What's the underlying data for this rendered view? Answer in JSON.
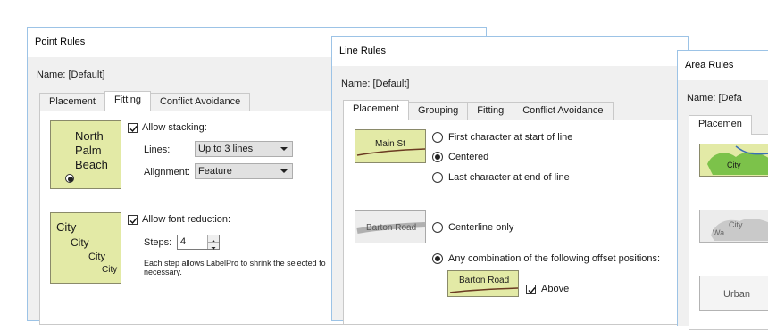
{
  "point": {
    "title": "Point Rules",
    "name_label": "Name:",
    "name_value": "[Default]",
    "tabs": [
      "Placement",
      "Fitting",
      "Conflict Avoidance"
    ],
    "stack_sample": [
      "North",
      "Palm",
      "Beach"
    ],
    "allow_stacking": "Allow stacking:",
    "lines_label": "Lines:",
    "lines_value": "Up to 3 lines",
    "alignment_label": "Alignment:",
    "alignment_value": "Feature",
    "reduction_sample": [
      "City",
      "City",
      "City",
      "City"
    ],
    "allow_font_reduction": "Allow font reduction:",
    "steps_label": "Steps:",
    "steps_value": "4",
    "step_help": "Each step allows LabelPro to shrink the selected fo",
    "step_help2": "necessary."
  },
  "line": {
    "title": "Line Rules",
    "name_label": "Name:",
    "name_value": "[Default]",
    "tabs": [
      "Placement",
      "Grouping",
      "Fitting",
      "Conflict Avoidance"
    ],
    "sample1": "Main St",
    "opt_first": "First character at start of line",
    "opt_centered": "Centered",
    "opt_last": "Last character at end of line",
    "sample2": "Barton Road",
    "opt_centerline": "Centerline only",
    "opt_any": "Any combination of the following offset positions:",
    "sample3": "Barton Road",
    "above": "Above"
  },
  "area": {
    "title": "Area Rules",
    "name_label": "Name:",
    "name_value": "[Defa",
    "tab": "Placemen",
    "s1": "City",
    "s2": "City",
    "s2b": "Wa",
    "s3": "Urban"
  },
  "colors": {
    "sample_fill": "#e3eaa6",
    "window_border": "#9cc3e6",
    "line_brown": "#6b3b22"
  }
}
